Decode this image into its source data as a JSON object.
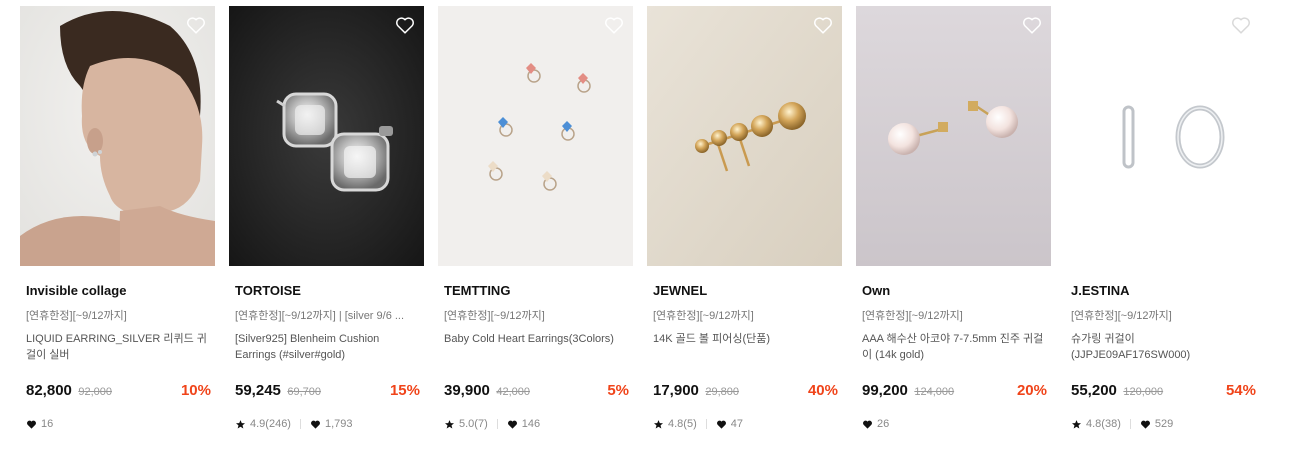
{
  "colors": {
    "discount": "#f0441a",
    "text": "#111111",
    "muted": "#888888"
  },
  "products": [
    {
      "brand": "Invisible collage",
      "promo": "[연휴한정][~9/12까지]",
      "name": "LIQUID EARRING_SILVER 리퀴드 귀걸이 실버",
      "price": "82,800",
      "original_price": "92,000",
      "discount": "10%",
      "rating": "",
      "likes": "16",
      "image_icon": "model-profile-image"
    },
    {
      "brand": "TORTOISE",
      "promo": "[연휴한정][~9/12까지] | [silver 9/6 ...",
      "name": "[Silver925] Blenheim Cushion Earrings (#silver#gold)",
      "price": "59,245",
      "original_price": "69,700",
      "discount": "15%",
      "rating": "4.9(246)",
      "likes": "1,793",
      "image_icon": "cushion-stud-image"
    },
    {
      "brand": "TEMTTING",
      "promo": "[연휴한정][~9/12까지]",
      "name": "Baby Cold Heart Earrings(3Colors)",
      "price": "39,900",
      "original_price": "42,000",
      "discount": "5%",
      "rating": "5.0(7)",
      "likes": "146",
      "image_icon": "heart-studs-image"
    },
    {
      "brand": "JEWNEL",
      "promo": "[연휴한정][~9/12까지]",
      "name": "14K 골드 볼 피어싱(단품)",
      "price": "17,900",
      "original_price": "29,800",
      "discount": "40%",
      "rating": "4.8(5)",
      "likes": "47",
      "image_icon": "gold-ball-image"
    },
    {
      "brand": "Own",
      "promo": "[연휴한정][~9/12까지]",
      "name": "AAA 해수산 아코야 7-7.5mm 진주 귀걸이 (14k gold)",
      "price": "99,200",
      "original_price": "124,000",
      "discount": "20%",
      "rating": "",
      "likes": "26",
      "image_icon": "pearl-studs-image"
    },
    {
      "brand": "J.ESTINA",
      "promo": "[연휴한정][~9/12까지]",
      "name": "슈가링 귀걸이 (JJPJE09AF176SW000)",
      "price": "55,200",
      "original_price": "120,000",
      "discount": "54%",
      "rating": "4.8(38)",
      "likes": "529",
      "image_icon": "hoop-earrings-image"
    }
  ]
}
